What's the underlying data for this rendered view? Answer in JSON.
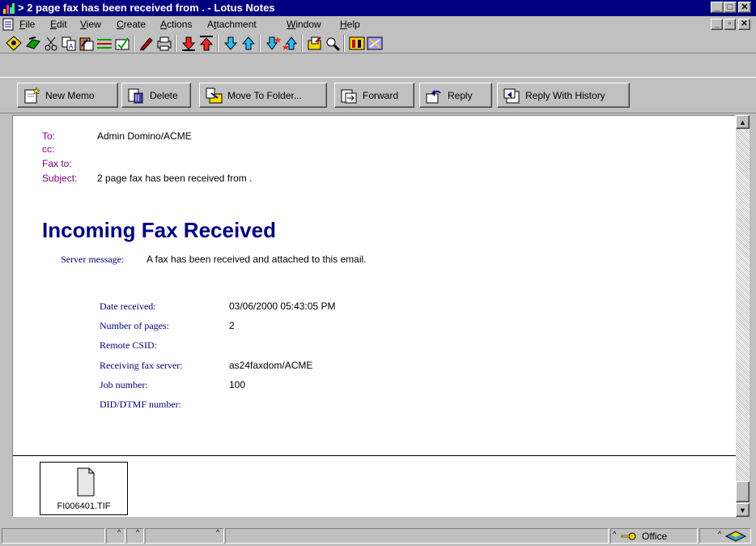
{
  "window": {
    "title": "2 page fax has been received from . - Lotus Notes",
    "prefix_glyph": ">"
  },
  "menu": {
    "items": [
      {
        "underline": "F",
        "rest": "ile"
      },
      {
        "underline": "E",
        "rest": "dit"
      },
      {
        "underline": "V",
        "rest": "iew"
      },
      {
        "underline": "C",
        "rest": "reate"
      },
      {
        "underline": "A",
        "rest": "ctions"
      },
      {
        "pre": "A",
        "underline": "t",
        "rest": "tachment"
      },
      {
        "underline": "W",
        "rest": "indow"
      },
      {
        "underline": "H",
        "rest": "elp"
      }
    ]
  },
  "actions": [
    {
      "label": "New Memo",
      "icon": "new-memo-icon"
    },
    {
      "label": "Delete",
      "icon": "delete-icon"
    },
    {
      "label": "Move To Folder...",
      "icon": "move-folder-icon"
    },
    {
      "label": "Forward",
      "icon": "forward-icon"
    },
    {
      "label": "Reply",
      "icon": "reply-icon"
    },
    {
      "label": "Reply With History",
      "icon": "reply-history-icon"
    }
  ],
  "header": {
    "to_label": "To:",
    "to_value": "Admin Domino/ACME",
    "cc_label": "cc:",
    "faxto_label": "Fax to:",
    "subject_label": "Subject:",
    "subject_value": "2 page fax has been received from ."
  },
  "body": {
    "heading": "Incoming Fax Received",
    "server_label": "Server message:",
    "server_message": "A fax has been received and attached to this email.",
    "fields": [
      {
        "label": "Date received:",
        "value": "03/06/2000 05:43:05 PM"
      },
      {
        "label": "Number of pages:",
        "value": "2"
      },
      {
        "label": "Remote CSID:",
        "value": ""
      },
      {
        "label": "Receiving fax server:",
        "value": "as24faxdom/ACME"
      },
      {
        "label": "Job number:",
        "value": "100"
      },
      {
        "label": "DID/DTMF number:",
        "value": ""
      }
    ]
  },
  "attachment": {
    "filename": "FI006401.TIF"
  },
  "status": {
    "location": "Office"
  },
  "colors": {
    "titlebar": "#000080",
    "heading": "#00008b",
    "label_purple": "#800080",
    "field_label": "#000080"
  }
}
